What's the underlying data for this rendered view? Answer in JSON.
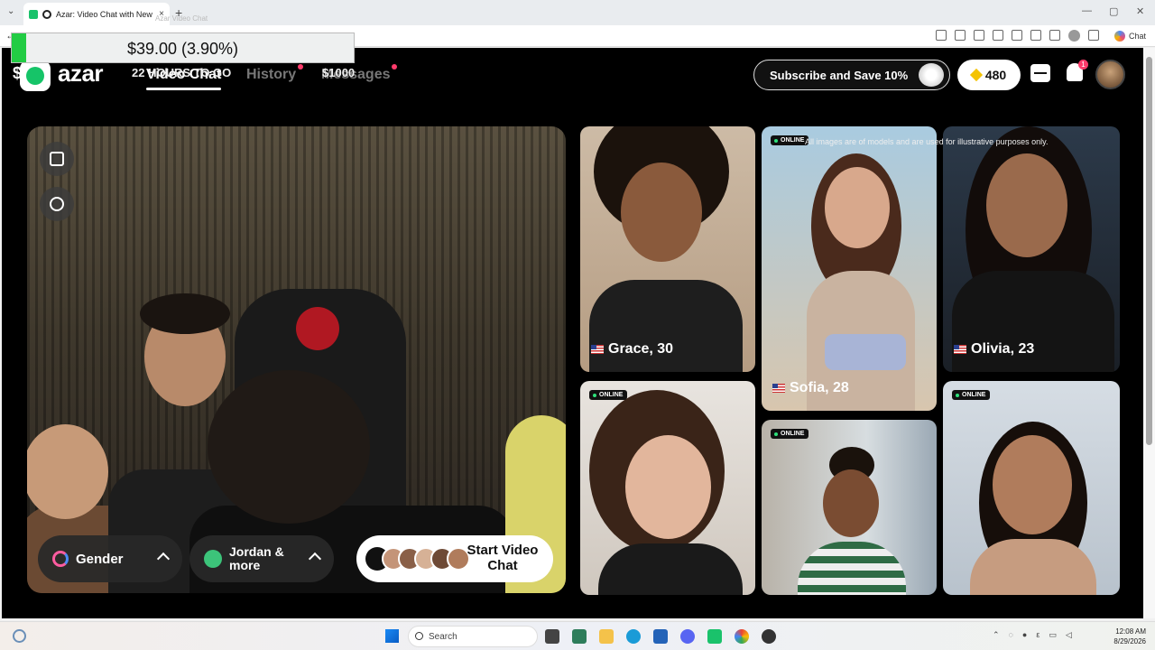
{
  "browser": {
    "tab_title": "Azar: Video Chat with New Pe",
    "tab_close": "×",
    "new_tab": "+",
    "chat_label": "Chat",
    "faint_label": "Azar Video Chat"
  },
  "overlay": {
    "amount": "$39.00 (3.90%)"
  },
  "stream_overlay": {
    "dollar": "$",
    "hours": "22 HOURS TO GO",
    "goal": "$1000"
  },
  "app": {
    "logo": "azar",
    "nav": {
      "video_chat": "Video Chat",
      "history": "History",
      "messages": "Messages"
    },
    "subscribe": "Subscribe and Save 10%",
    "gems": "480",
    "notification_count": "1",
    "colors": {
      "brand": "#16c468",
      "badge": "#ff3b6b",
      "online": "#2ee07a"
    }
  },
  "video_controls": {
    "gender": "Gender",
    "filter_line1": "Jordan &",
    "filter_line2": "more",
    "start_line1": "Start Video",
    "start_line2": "Chat"
  },
  "cards": {
    "disclaimer": "All images are of models and are used for illustrative purposes only.",
    "online_label": "ONLINE",
    "grace": "Grace, 30",
    "sofia": "Sofia, 28",
    "olivia": "Olivia, 23"
  },
  "taskbar": {
    "search": "Search",
    "time": "12:08 AM",
    "date": "8/29/2026"
  }
}
